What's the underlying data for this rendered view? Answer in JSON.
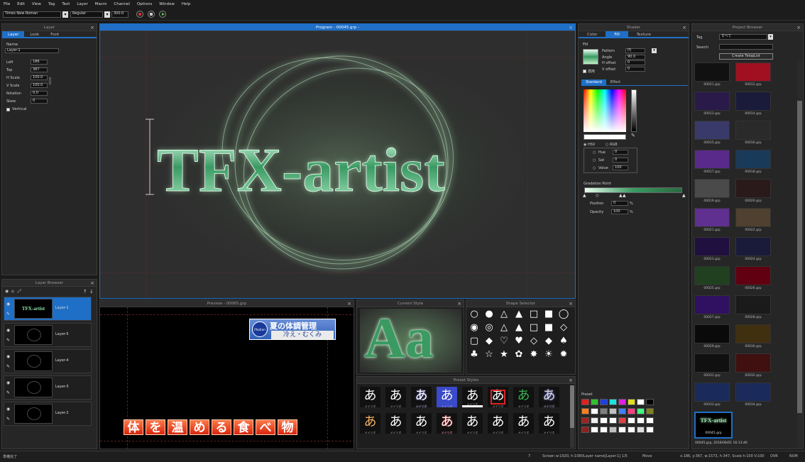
{
  "menu": [
    "File",
    "Edit",
    "View",
    "Tag",
    "Text",
    "Layer",
    "Macro",
    "Channel",
    "Options",
    "Window",
    "Help"
  ],
  "toolbar": {
    "font": "Times New Roman",
    "style": "Regular",
    "size": "300.0"
  },
  "layer_panel": {
    "title": "Layer",
    "tabs": [
      "Layer",
      "Look",
      "Font"
    ],
    "name_label": "Name",
    "name_value": "Layer-1",
    "fields": [
      {
        "label": "Left",
        "value": "186"
      },
      {
        "label": "Top",
        "value": "387"
      },
      {
        "label": "H Scale",
        "value": "100.0"
      },
      {
        "label": "V Scale",
        "value": "100.0"
      },
      {
        "label": "Rotation",
        "value": "0.0"
      },
      {
        "label": "Skew",
        "value": "0"
      }
    ],
    "vertical_label": "Vertical"
  },
  "program": {
    "title": "Program - 00045.grp -",
    "text": "TFX-artist"
  },
  "shader": {
    "title": "Shader",
    "tabs": [
      "Color",
      "Fill",
      "Texture"
    ],
    "sub_label": "Fill",
    "rows": [
      {
        "label": "Pattern",
        "value": "円"
      },
      {
        "label": "Angle",
        "value": "90.0"
      },
      {
        "label": "H offset",
        "value": "0"
      },
      {
        "label": "V offset",
        "value": "0"
      }
    ],
    "cb_label": "適用",
    "modes": [
      "Standard",
      "Effect"
    ],
    "color_modes": [
      "HSV",
      "RGB"
    ],
    "hsv": [
      {
        "label": "Hue",
        "value": "0"
      },
      {
        "label": "Sat",
        "value": "0"
      },
      {
        "label": "Value",
        "value": "100"
      }
    ],
    "grad_label": "Gradation Point",
    "position_label": "Position",
    "position_value": "0",
    "opacity_label": "Opacity",
    "opacity_value": "100",
    "preset_label": "Preset"
  },
  "project": {
    "title": "Project Browser",
    "tag_label": "Tag",
    "tag_value": "すべて",
    "search_label": "Search",
    "create_label": "Create TelopList",
    "items": [
      "00011.grp",
      "00012.grp",
      "00013.grp",
      "00014.grp",
      "00015.grp",
      "00016.grp",
      "00017.grp",
      "00018.grp",
      "00019.grp",
      "00020.grp",
      "00021.grp",
      "00022.grp",
      "00023.grp",
      "00024.grp",
      "00025.grp",
      "00026.grp",
      "00027.grp",
      "00028.grp",
      "00029.grp",
      "00030.grp",
      "00031.grp",
      "00032.grp",
      "00033.grp",
      "00034.grp"
    ],
    "selected": "00045.grp",
    "selected_thumb_text": "TFX-artist",
    "caption": "00045.grp, 2016/08/01 16:13:46"
  },
  "layer_browser": {
    "title": "Layer Browser",
    "layers": [
      "Layer-1",
      "Layer-5",
      "Layer-4",
      "Layer-3",
      "Layer-2"
    ],
    "thumb_text": "TFX-artist"
  },
  "preview": {
    "title": "Preview - 00065.grp",
    "banner_title": "夏の体調管理",
    "banner_sub": "冷え・むくみ",
    "banner_logo": "Photron",
    "bottom_chars": [
      "体",
      "を",
      "温",
      "め",
      "る",
      "食",
      "べ",
      "物"
    ]
  },
  "current_style": {
    "title": "Current Style",
    "sample": "Aa"
  },
  "shape_selector": {
    "title": "Shape Selector",
    "shapes": [
      "○",
      "●",
      "△",
      "▲",
      "□",
      "■",
      "◯",
      "◉",
      "◎",
      "△",
      "▲",
      "□",
      "■",
      "◇",
      "▢",
      "◆",
      "♡",
      "♥",
      "◇",
      "◆",
      "♠",
      "♣",
      "☆",
      "★",
      "✿",
      "✸",
      "☀",
      "✹"
    ]
  },
  "preset_styles": {
    "title": "Preset Styles",
    "row1": [
      "あ",
      "あ",
      "あ",
      "あ",
      "あ",
      "あ",
      "あ",
      "あ"
    ],
    "row2": [
      "あ",
      "あ",
      "あ",
      "あ",
      "あ",
      "あ",
      "あ",
      "あ"
    ],
    "caption": "メイリオ"
  },
  "status": {
    "left": "準備完了",
    "page": "7",
    "screen": "Screen w:1920, h:1080",
    "layer": "Layer name[Layer-1] 1/5",
    "mode": "Move",
    "coords": "x:186, y:367, w:1573, h:347, Scale h:100 V:100",
    "ovr": "OVR",
    "num": "NUM"
  },
  "colors": {
    "accent": "#1f6fc6",
    "glow": "#8fe0a8",
    "text_green": "#2f8a55"
  }
}
